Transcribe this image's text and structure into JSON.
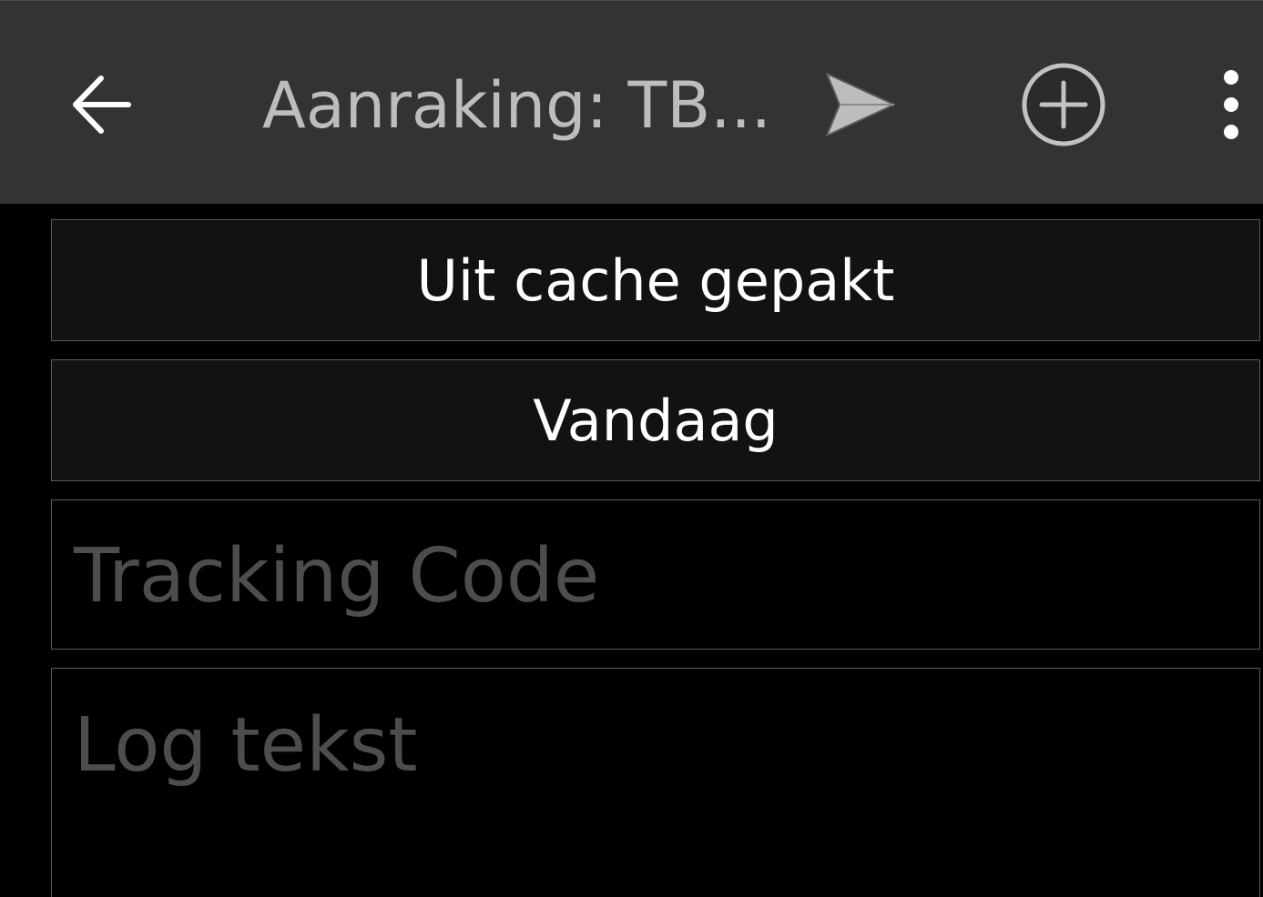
{
  "toolbar": {
    "title": "Aanraking: TB...",
    "icons": {
      "back": "arrow-left-icon",
      "send": "send-icon",
      "add": "add-circle-icon",
      "more": "more-vert-icon"
    },
    "colors": {
      "background": "#333333",
      "icon": "#ffffff",
      "title": "#bdbdbd"
    }
  },
  "form": {
    "log_type_label": "Uit cache gepakt",
    "date_label": "Vandaag",
    "tracking_code": {
      "value": "",
      "placeholder": "Tracking Code"
    },
    "log_text": {
      "value": "",
      "placeholder": "Log tekst"
    }
  }
}
